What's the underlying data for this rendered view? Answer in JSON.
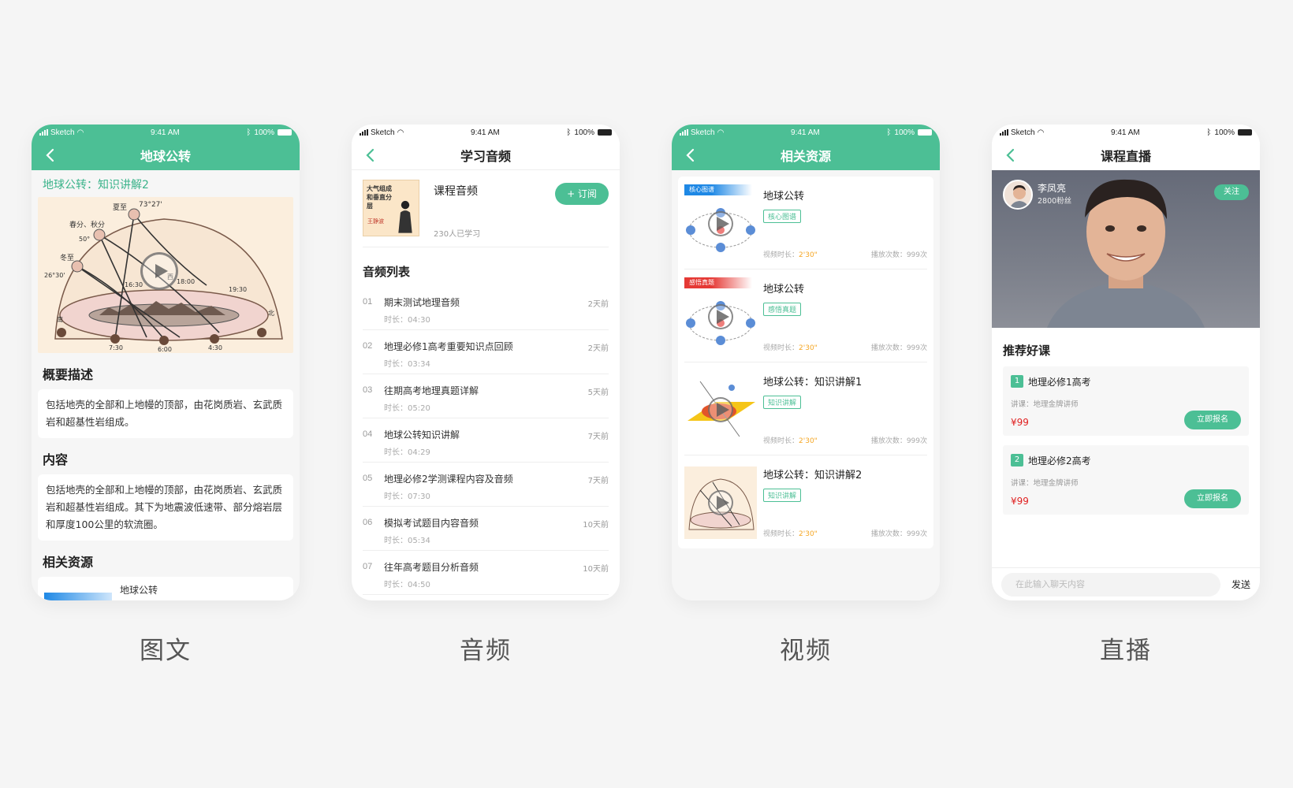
{
  "status": {
    "carrier": "Sketch",
    "time": "9:41 AM",
    "battery": "100%"
  },
  "colors": {
    "accent": "#4cbf95",
    "background": "#f5f5f5",
    "price": "#e02020",
    "duration": "#f5a623"
  },
  "phone1": {
    "nav_title": "地球公转",
    "subtitle": "地球公转：知识讲解2",
    "diagram_labels": {
      "summer": "夏至",
      "equinox": "春分、秋分",
      "winter": "冬至",
      "a1": "73°27'",
      "a2": "50°",
      "a3": "26°30'",
      "t1": "16:30",
      "t2": "18:00",
      "t3": "19:30",
      "t4": "7:30",
      "t5": "6:00",
      "t6": "4:30",
      "south": "南",
      "west": "西",
      "north": "北"
    },
    "desc_title": "概要描述",
    "desc_text": "包括地壳的全部和上地幔的顶部，由花岗质岩、玄武质岩和超基性岩组成。",
    "content_title": "内容",
    "content_text": "包括地壳的全部和上地幔的顶部，由花岗质岩、玄武质岩和超基性岩组成。其下为地震波低速带、部分熔岩层和厚度100公里的软流圈。",
    "related_title": "相关资源",
    "related_peek": "地球公转",
    "caption": "图文"
  },
  "phone2": {
    "nav_title": "学习音频",
    "cover_text": "大气组成和垂直分层",
    "cover_author": "王静波",
    "course_title": "课程音频",
    "learners": "230人已学习",
    "subscribe": "+ 订阅",
    "list_title": "音频列表",
    "items": [
      {
        "num": "01",
        "title": "期末测试地理音频",
        "dur": "时长：04:30",
        "ago": "2天前"
      },
      {
        "num": "02",
        "title": "地理必修1高考重要知识点回顾",
        "dur": "时长：03:34",
        "ago": "2天前"
      },
      {
        "num": "03",
        "title": "往期高考地理真题详解",
        "dur": "时长：05:20",
        "ago": "5天前"
      },
      {
        "num": "04",
        "title": "地球公转知识讲解",
        "dur": "时长：04:29",
        "ago": "7天前"
      },
      {
        "num": "05",
        "title": "地理必修2学测课程内容及音频",
        "dur": "时长：07:30",
        "ago": "7天前"
      },
      {
        "num": "06",
        "title": "模拟考试题目内容音频",
        "dur": "时长：05:34",
        "ago": "10天前"
      },
      {
        "num": "07",
        "title": "往年高考题目分析音频",
        "dur": "时长：04:50",
        "ago": "10天前"
      }
    ],
    "caption": "音频"
  },
  "phone3": {
    "nav_title": "相关资源",
    "items": [
      {
        "tag": "核心图谱",
        "tag_color": "#1e88e5",
        "title": "地球公转",
        "badge": "核心图谱",
        "dur_label": "视频时长：",
        "dur": "2'30\"",
        "plays": "播放次数：999次"
      },
      {
        "tag": "感悟真题",
        "tag_color": "#e53935",
        "title": "地球公转",
        "badge": "感悟真题",
        "dur_label": "视频时长：",
        "dur": "2'30\"",
        "plays": "播放次数：999次"
      },
      {
        "tag": "",
        "tag_color": "",
        "title": "地球公转：知识讲解1",
        "badge": "知识讲解",
        "dur_label": "视频时长：",
        "dur": "2'30\"",
        "plays": "播放次数：999次"
      },
      {
        "tag": "",
        "tag_color": "",
        "title": "地球公转：知识讲解2",
        "badge": "知识讲解",
        "dur_label": "视频时长：",
        "dur": "2'30\"",
        "plays": "播放次数：999次"
      }
    ],
    "caption": "视频"
  },
  "phone4": {
    "nav_title": "课程直播",
    "host_name": "李凤亮",
    "fans": "2800粉丝",
    "follow": "关注",
    "rec_title": "推荐好课",
    "courses": [
      {
        "num": "1",
        "title": "地理必修1高考",
        "teacher": "讲课：地理金牌讲师",
        "price": "¥99",
        "enroll": "立即报名"
      },
      {
        "num": "2",
        "title": "地理必修2高考",
        "teacher": "讲课：地理金牌讲师",
        "price": "¥99",
        "enroll": "立即报名"
      }
    ],
    "chat_placeholder": "在此输入聊天内容",
    "send": "发送",
    "caption": "直播"
  }
}
